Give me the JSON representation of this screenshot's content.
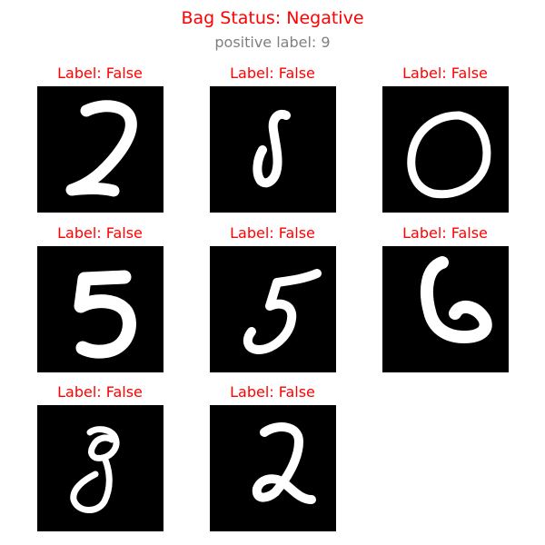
{
  "title": "Bag Status: Negative",
  "subtitle": "positive label: 9",
  "title_color": "#ff0000",
  "subtitle_color": "#808080",
  "label_color": "#ff0000",
  "cells": [
    {
      "label": "Label: False",
      "digit": "2"
    },
    {
      "label": "Label: False",
      "digit": "J"
    },
    {
      "label": "Label: False",
      "digit": "0"
    },
    {
      "label": "Label: False",
      "digit": "5"
    },
    {
      "label": "Label: False",
      "digit": "5"
    },
    {
      "label": "Label: False",
      "digit": "6"
    },
    {
      "label": "Label: False",
      "digit": "8"
    },
    {
      "label": "Label: False",
      "digit": "2"
    }
  ]
}
